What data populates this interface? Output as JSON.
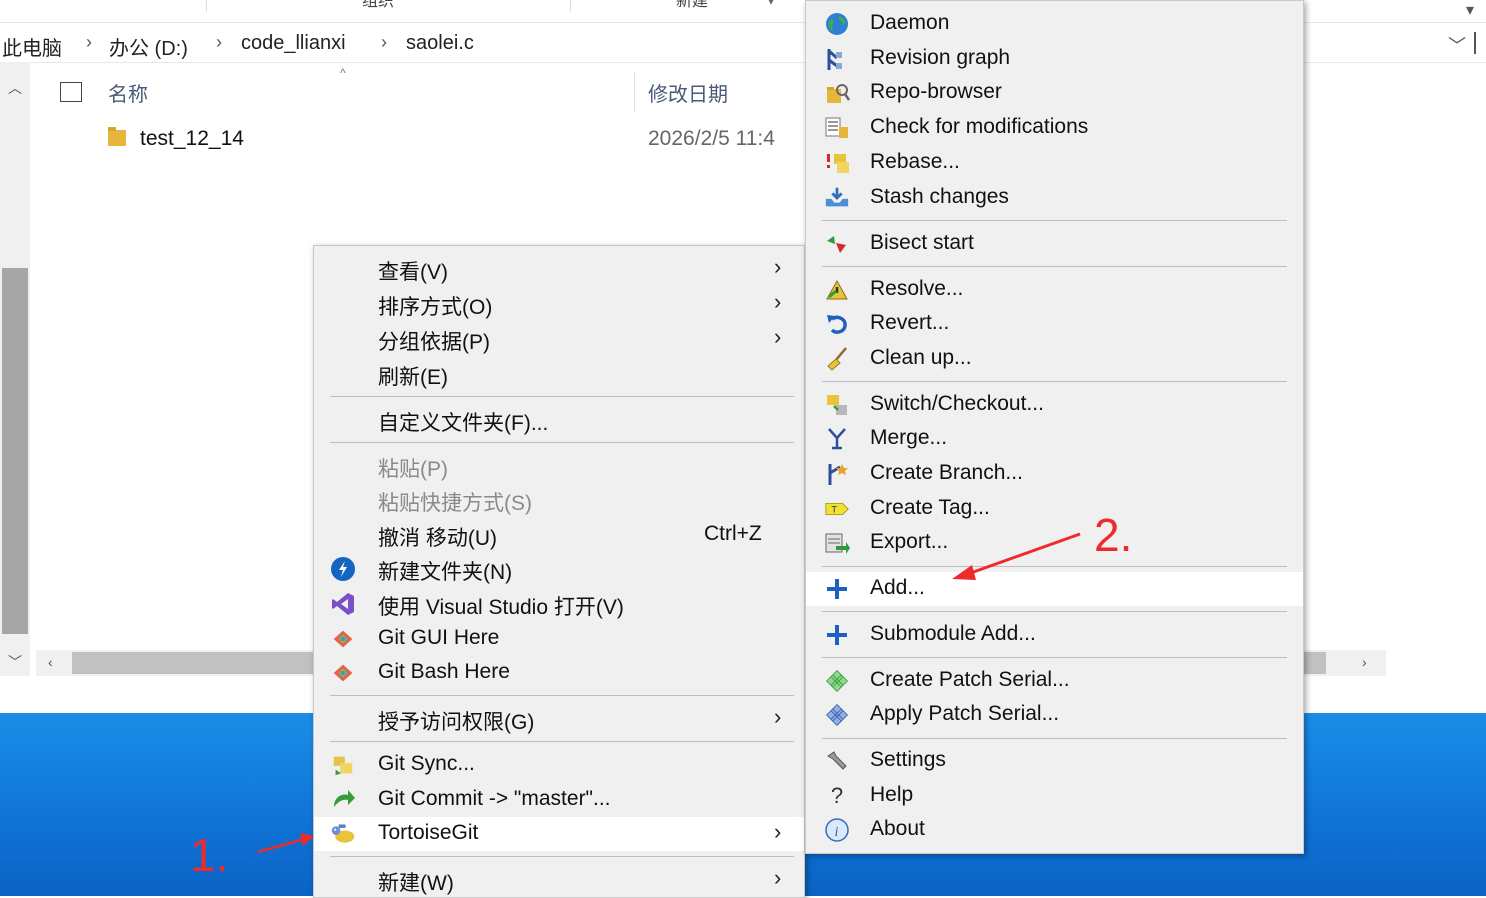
{
  "explorer": {
    "toolbar_tabs": [
      "组织",
      "新建"
    ],
    "breadcrumb": [
      "此电脑",
      "办公 (D:)",
      "code_llianxi",
      "saolei.c"
    ],
    "columns": {
      "name": "名称",
      "modified": "修改日期"
    },
    "files": [
      {
        "name": "test_12_14",
        "modified": "2026/2/5 11:4"
      }
    ]
  },
  "context_menu": {
    "items": [
      {
        "label": "查看(V)",
        "submenu": true
      },
      {
        "label": "排序方式(O)",
        "submenu": true
      },
      {
        "label": "分组依据(P)",
        "submenu": true
      },
      {
        "label": "刷新(E)"
      },
      {
        "label": "自定义文件夹(F)..."
      },
      {
        "label": "粘贴(P)",
        "disabled": true
      },
      {
        "label": "粘贴快捷方式(S)",
        "disabled": true
      },
      {
        "label": "撤消 移动(U)",
        "shortcut": "Ctrl+Z"
      },
      {
        "label": "新建文件夹(N)",
        "icon": "new-folder-icon"
      },
      {
        "label": "使用 Visual Studio 打开(V)",
        "icon": "visual-studio-icon"
      },
      {
        "label": "Git GUI Here",
        "icon": "git-gui-icon"
      },
      {
        "label": "Git Bash Here",
        "icon": "git-bash-icon"
      },
      {
        "label": "授予访问权限(G)",
        "submenu": true
      },
      {
        "label": "Git Sync...",
        "icon": "git-sync-icon"
      },
      {
        "label": "Git Commit -> \"master\"...",
        "icon": "git-commit-icon"
      },
      {
        "label": "TortoiseGit",
        "icon": "tortoisegit-icon",
        "submenu": true,
        "highlighted": true
      },
      {
        "label": "新建(W)",
        "submenu": true
      }
    ]
  },
  "tortoise_menu": {
    "items": [
      {
        "label": "Daemon",
        "icon": "globe-icon"
      },
      {
        "label": "Revision graph",
        "icon": "revision-graph-icon"
      },
      {
        "label": "Repo-browser",
        "icon": "repo-browser-icon"
      },
      {
        "label": "Check for modifications",
        "icon": "check-modifications-icon"
      },
      {
        "label": "Rebase...",
        "icon": "rebase-icon"
      },
      {
        "label": "Stash changes",
        "icon": "stash-icon"
      },
      {
        "label": "Bisect start",
        "icon": "bisect-icon"
      },
      {
        "label": "Resolve...",
        "icon": "resolve-icon"
      },
      {
        "label": "Revert...",
        "icon": "revert-icon"
      },
      {
        "label": "Clean up...",
        "icon": "cleanup-icon"
      },
      {
        "label": "Switch/Checkout...",
        "icon": "switch-icon"
      },
      {
        "label": "Merge...",
        "icon": "merge-icon"
      },
      {
        "label": "Create Branch...",
        "icon": "branch-icon"
      },
      {
        "label": "Create Tag...",
        "icon": "tag-icon"
      },
      {
        "label": "Export...",
        "icon": "export-icon"
      },
      {
        "label": "Add...",
        "icon": "add-icon",
        "highlighted": true
      },
      {
        "label": "Submodule Add...",
        "icon": "submodule-add-icon"
      },
      {
        "label": "Create Patch Serial...",
        "icon": "patch-create-icon"
      },
      {
        "label": "Apply Patch Serial...",
        "icon": "patch-apply-icon"
      },
      {
        "label": "Settings",
        "icon": "settings-icon"
      },
      {
        "label": "Help",
        "icon": "help-icon"
      },
      {
        "label": "About",
        "icon": "about-icon"
      }
    ]
  },
  "annotations": {
    "step1": "1.",
    "step2": "2.",
    "color": "#ee2a2a"
  },
  "shortcut_undo": "Ctrl+Z"
}
